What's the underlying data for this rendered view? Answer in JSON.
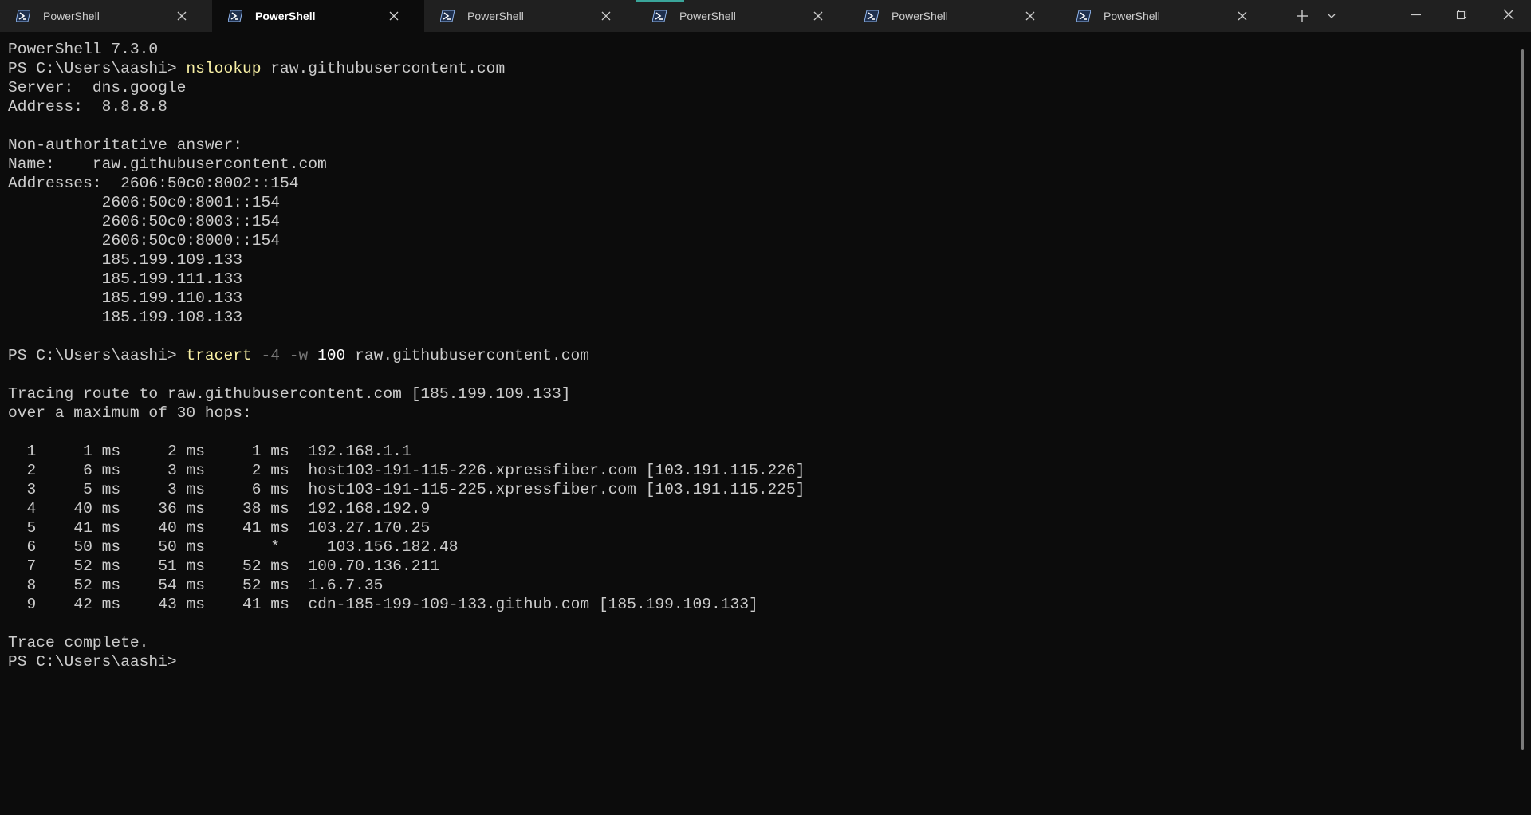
{
  "window": {
    "tabs": [
      {
        "label": "PowerShell",
        "active": false
      },
      {
        "label": "PowerShell",
        "active": true
      },
      {
        "label": "PowerShell",
        "active": false
      },
      {
        "label": "PowerShell",
        "active": false
      },
      {
        "label": "PowerShell",
        "active": false
      },
      {
        "label": "PowerShell",
        "active": false
      }
    ],
    "colors": {
      "titlebar": "#202020",
      "terminal_bg": "#0c0c0c",
      "text": "#cccccc",
      "command": "#f9f1a5",
      "flag": "#767676",
      "accent": "#3aa59a"
    },
    "icons": {
      "tab_icon": "powershell-icon",
      "tab_close": "close-icon",
      "new_tab": "plus-icon",
      "dropdown": "chevron-down-icon",
      "minimize": "minimize-icon",
      "restore": "restore-icon",
      "close": "close-icon"
    }
  },
  "terminal": {
    "version_line": "PowerShell 7.3.0",
    "prompt": "PS C:\\Users\\aashi> ",
    "nslookup": {
      "command": "nslookup",
      "argument": " raw.githubusercontent.com",
      "output": [
        "Server:  dns.google",
        "Address:  8.8.8.8",
        "",
        "Non-authoritative answer:",
        "Name:    raw.githubusercontent.com",
        "Addresses:  2606:50c0:8002::154",
        "          2606:50c0:8001::154",
        "          2606:50c0:8003::154",
        "          2606:50c0:8000::154",
        "          185.199.109.133",
        "          185.199.111.133",
        "          185.199.110.133",
        "          185.199.108.133",
        ""
      ]
    },
    "tracert": {
      "command": "tracert",
      "flag1": " -4",
      "flag2": " -w",
      "value": " 100",
      "argument": " raw.githubusercontent.com",
      "header": [
        "",
        "Tracing route to raw.githubusercontent.com [185.199.109.133]",
        "over a maximum of 30 hops:",
        ""
      ],
      "hops": [
        {
          "hop": "1",
          "t1": "1 ms",
          "t2": "2 ms",
          "t3": "1 ms",
          "host": "192.168.1.1"
        },
        {
          "hop": "2",
          "t1": "6 ms",
          "t2": "3 ms",
          "t3": "2 ms",
          "host": "host103-191-115-226.xpressfiber.com [103.191.115.226]"
        },
        {
          "hop": "3",
          "t1": "5 ms",
          "t2": "3 ms",
          "t3": "6 ms",
          "host": "host103-191-115-225.xpressfiber.com [103.191.115.225]"
        },
        {
          "hop": "4",
          "t1": "40 ms",
          "t2": "36 ms",
          "t3": "38 ms",
          "host": "192.168.192.9"
        },
        {
          "hop": "5",
          "t1": "41 ms",
          "t2": "40 ms",
          "t3": "41 ms",
          "host": "103.27.170.25"
        },
        {
          "hop": "6",
          "t1": "50 ms",
          "t2": "50 ms",
          "t3": "*",
          "host": "103.156.182.48"
        },
        {
          "hop": "7",
          "t1": "52 ms",
          "t2": "51 ms",
          "t3": "52 ms",
          "host": "100.70.136.211"
        },
        {
          "hop": "8",
          "t1": "52 ms",
          "t2": "54 ms",
          "t3": "52 ms",
          "host": "1.6.7.35"
        },
        {
          "hop": "9",
          "t1": "42 ms",
          "t2": "43 ms",
          "t3": "41 ms",
          "host": "cdn-185-199-109-133.github.com [185.199.109.133]"
        }
      ],
      "footer": [
        "",
        "Trace complete."
      ]
    }
  }
}
